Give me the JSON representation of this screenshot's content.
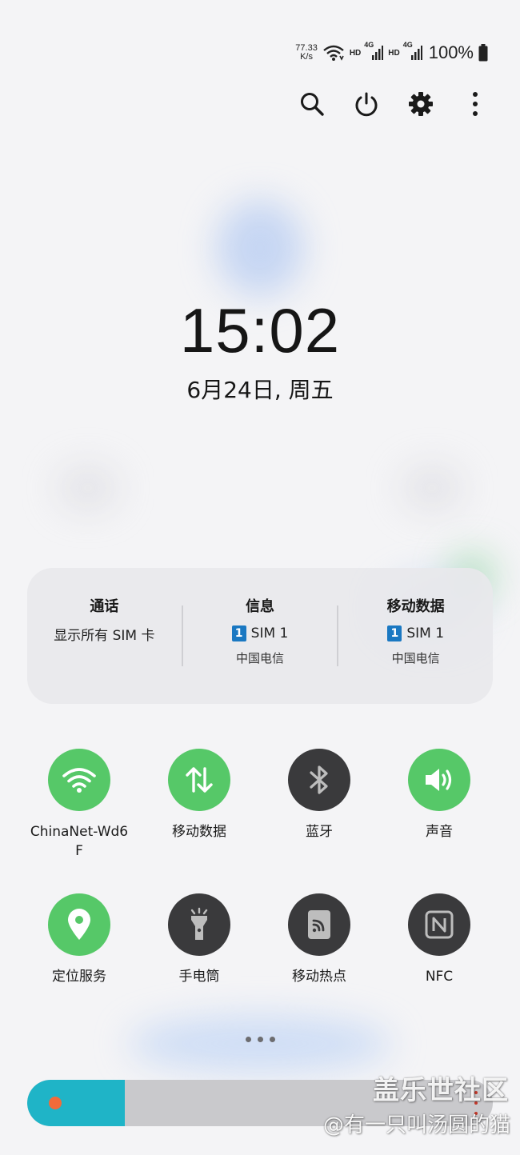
{
  "status_bar": {
    "net_speed_value": "77.33",
    "net_speed_unit": "K/s",
    "hd1": "HD",
    "hd2": "HD",
    "signal1_label": "4G",
    "signal2_label": "4G",
    "battery_percent": "100%",
    "icons": [
      "wifi-icon",
      "signal-icon",
      "signal-icon",
      "battery-icon"
    ]
  },
  "top_actions": {
    "icons": [
      "search-icon",
      "power-icon",
      "settings-icon",
      "more-vertical-icon"
    ]
  },
  "clock": {
    "time": "15:02",
    "date": "6月24日, 周五"
  },
  "sim_panel": {
    "call": {
      "title": "通话",
      "value": "显示所有 SIM 卡"
    },
    "messages": {
      "title": "信息",
      "sim_num": "1",
      "sim_label": "SIM 1",
      "carrier": "中国电信"
    },
    "mobile_data": {
      "title": "移动数据",
      "sim_num": "1",
      "sim_label": "SIM 1",
      "carrier": "中国电信"
    }
  },
  "tiles": [
    {
      "label": "ChinaNet-Wd6F",
      "icon": "wifi-icon",
      "state": "on"
    },
    {
      "label": "移动数据",
      "icon": "mobile-data-arrows-icon",
      "state": "on"
    },
    {
      "label": "蓝牙",
      "icon": "bluetooth-icon",
      "state": "off"
    },
    {
      "label": "声音",
      "icon": "volume-icon",
      "state": "on"
    },
    {
      "label": "定位服务",
      "icon": "location-pin-icon",
      "state": "on"
    },
    {
      "label": "手电筒",
      "icon": "flashlight-icon",
      "state": "off"
    },
    {
      "label": "移动热点",
      "icon": "hotspot-icon",
      "state": "off"
    },
    {
      "label": "NFC",
      "icon": "nfc-icon",
      "state": "off"
    }
  ],
  "brightness": {
    "level": 0.21
  },
  "watermark": {
    "title": "盖乐世社区",
    "user": "@有一只叫汤圆的猫"
  },
  "colors": {
    "tile_on": "#56c868",
    "tile_off": "#3a3a3c",
    "brightness_fill": "#1fb4c7",
    "sim_badge": "#1a78c2"
  }
}
